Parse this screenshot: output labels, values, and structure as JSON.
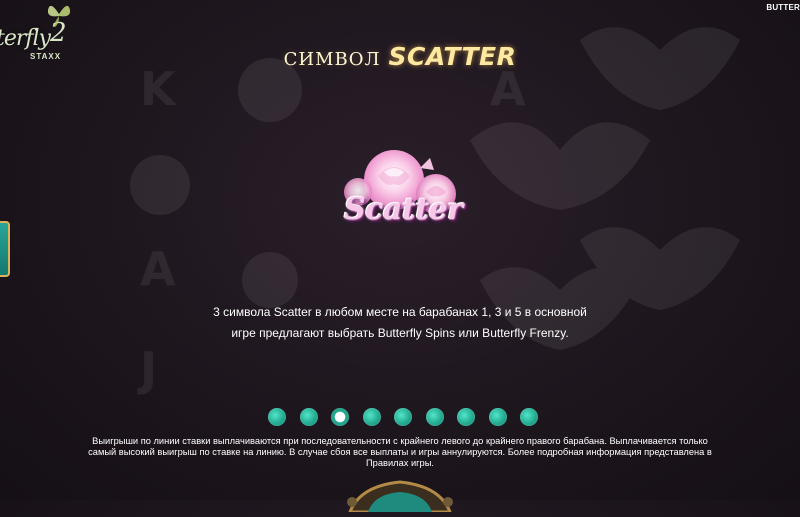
{
  "logo": {
    "text": "terfly",
    "number": "2",
    "sub": "STAXX"
  },
  "corner_label": "BUTTER",
  "title": {
    "main": "символ",
    "accent": "SCATTER"
  },
  "symbol": {
    "label": "Scatter",
    "icon": "rose-scatter-icon"
  },
  "description": "3 символа Scatter в любом месте на барабанах 1, 3 и 5 в основной игре предлагают выбрать Butterfly Spins или Butterfly Frenzy.",
  "pager": {
    "total": 9,
    "active_index": 2
  },
  "footer": "Выигрыши по линии ставки выплачиваются при последовательности с крайнего левого до крайнего правого барабана. Выплачивается только самый высокий выигрыш по ставке на линию. В случае сбоя все выплаты и игры аннулируются. Более подробная информация представлена в Правилах игры.",
  "colors": {
    "accent_teal": "#22b093",
    "title_gold": "#ffe8a0",
    "symbol_pink": "#f6c7e9",
    "background": "#1d161d"
  }
}
